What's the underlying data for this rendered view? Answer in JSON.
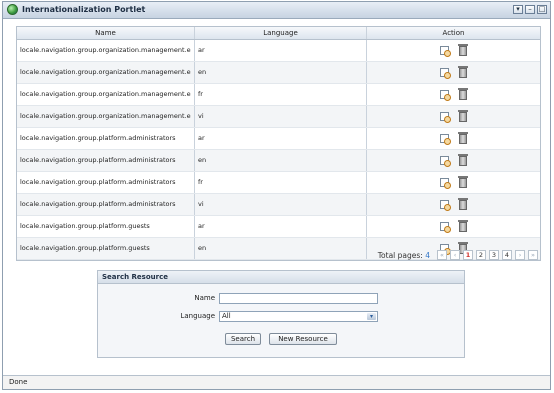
{
  "portlet": {
    "title": "Internationalization Portlet",
    "buttons": [
      "▾",
      "–",
      "□"
    ]
  },
  "grid": {
    "headers": {
      "name": "Name",
      "language": "Language",
      "action": "Action"
    },
    "rows": [
      {
        "name": "locale.navigation.group.organization.management.e",
        "language": "ar"
      },
      {
        "name": "locale.navigation.group.organization.management.e",
        "language": "en"
      },
      {
        "name": "locale.navigation.group.organization.management.e",
        "language": "fr"
      },
      {
        "name": "locale.navigation.group.organization.management.e",
        "language": "vi"
      },
      {
        "name": "locale.navigation.group.platform.administrators",
        "language": "ar"
      },
      {
        "name": "locale.navigation.group.platform.administrators",
        "language": "en"
      },
      {
        "name": "locale.navigation.group.platform.administrators",
        "language": "fr"
      },
      {
        "name": "locale.navigation.group.platform.administrators",
        "language": "vi"
      },
      {
        "name": "locale.navigation.group.platform.guests",
        "language": "ar"
      },
      {
        "name": "locale.navigation.group.platform.guests",
        "language": "en"
      }
    ],
    "action_icons": [
      "view-icon",
      "delete-icon"
    ]
  },
  "pagination": {
    "label": "Total pages:",
    "total": "4",
    "first": "«",
    "prev": "‹",
    "pages": [
      "1",
      "2",
      "3",
      "4"
    ],
    "current": "1",
    "next": "›",
    "last": "»"
  },
  "search": {
    "title": "Search Resource",
    "name_label": "Name",
    "name_value": "",
    "language_label": "Language",
    "language_value": "All",
    "search_button": "Search",
    "new_button": "New Resource"
  },
  "status": {
    "text": "Done"
  },
  "colors": {
    "accent": "#3477c8",
    "current_page": "#d2322d",
    "border": "#b6c1cd"
  }
}
